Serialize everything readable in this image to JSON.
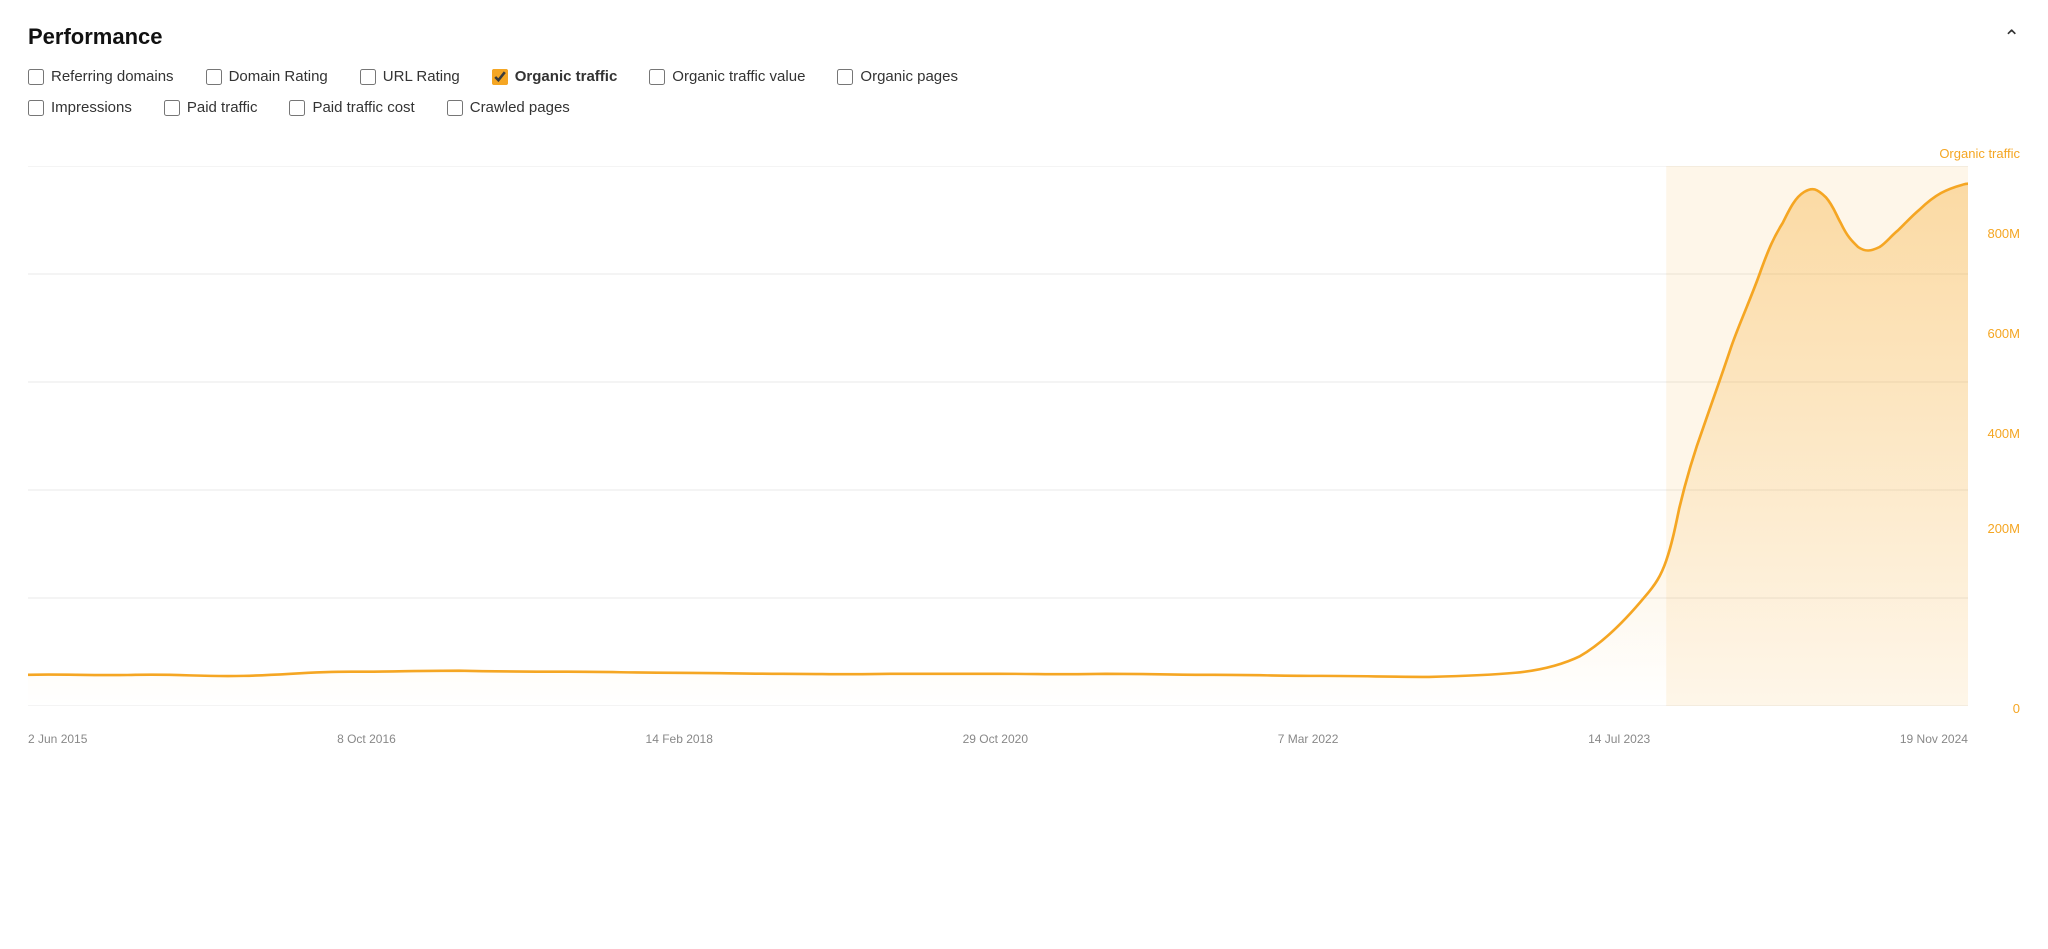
{
  "header": {
    "title": "Performance",
    "collapse_icon": "chevron-up"
  },
  "checkboxes": {
    "row1": [
      {
        "id": "referring-domains",
        "label": "Referring domains",
        "checked": false
      },
      {
        "id": "domain-rating",
        "label": "Domain Rating",
        "checked": false
      },
      {
        "id": "url-rating",
        "label": "URL Rating",
        "checked": false
      },
      {
        "id": "organic-traffic",
        "label": "Organic traffic",
        "checked": true
      },
      {
        "id": "organic-traffic-value",
        "label": "Organic traffic value",
        "checked": false
      },
      {
        "id": "organic-pages",
        "label": "Organic pages",
        "checked": false
      }
    ],
    "row2": [
      {
        "id": "impressions",
        "label": "Impressions",
        "checked": false
      },
      {
        "id": "paid-traffic",
        "label": "Paid traffic",
        "checked": false
      },
      {
        "id": "paid-traffic-cost",
        "label": "Paid traffic cost",
        "checked": false
      },
      {
        "id": "crawled-pages",
        "label": "Crawled pages",
        "checked": false
      }
    ]
  },
  "chart": {
    "y_axis_label": "Organic traffic",
    "y_labels": [
      "800M",
      "600M",
      "400M",
      "200M",
      "0"
    ],
    "x_labels": [
      "2 Jun 2015",
      "8 Oct 2016",
      "14 Feb 2018",
      "29 Oct 2020",
      "7 Mar 2022",
      "14 Jul 2023",
      "19 Nov 2024"
    ],
    "series_color": "#f5a623",
    "highlight_color": "rgba(245,166,35,0.12)"
  }
}
